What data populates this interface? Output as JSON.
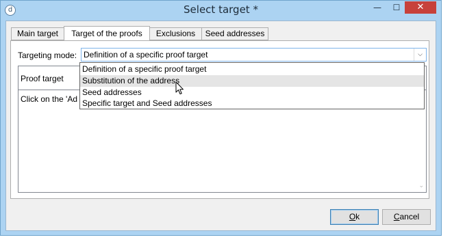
{
  "window": {
    "title": "Select target *",
    "app_icon_glyph": "d",
    "controls": {
      "minimize": "—",
      "maximize": "☐",
      "close": "✕"
    }
  },
  "tabs": [
    {
      "label": "Main target"
    },
    {
      "label": "Target of the proofs",
      "active": true
    },
    {
      "label": "Exclusions"
    },
    {
      "label": "Seed addresses"
    }
  ],
  "targeting_mode": {
    "label": "Targeting mode:",
    "value": "Definition of a specific proof target",
    "arrow": "⌵"
  },
  "dropdown": {
    "options": [
      "Definition of a specific proof target",
      "Substitution of the address",
      "Seed addresses",
      "Specific target and Seed addresses"
    ],
    "hovered_index": 1
  },
  "proof_target": {
    "label": "Proof target",
    "description": "Click on the 'Ad"
  },
  "buttons": {
    "ok_mnemonic": "O",
    "ok_rest": "k",
    "cancel_mnemonic": "C",
    "cancel_rest": "ancel"
  },
  "icons": {
    "scroll_up": "scroll-up-icon",
    "scroll_down": "scroll-down-icon",
    "cursor": "mouse-pointer-icon"
  }
}
